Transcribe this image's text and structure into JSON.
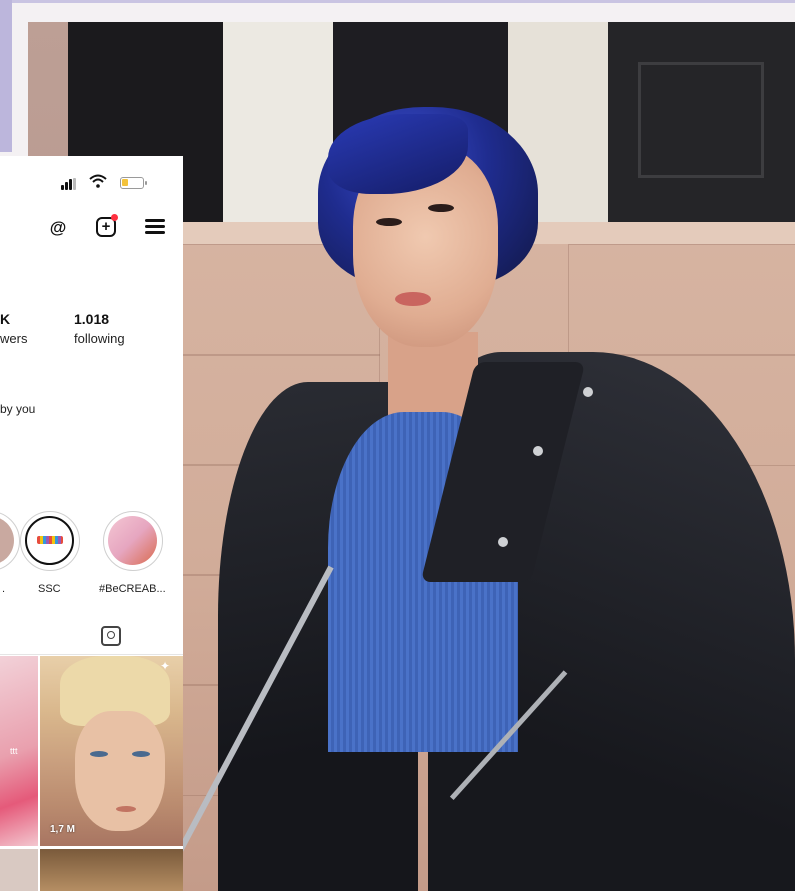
{
  "profile": {
    "followers": {
      "value": "K",
      "label": "wers"
    },
    "following": {
      "value": "1.018",
      "label": "following"
    },
    "mutual_text": "by you"
  },
  "highlights": [
    {
      "label": "."
    },
    {
      "label": "SSC"
    },
    {
      "label": "#BeCREAB..."
    }
  ],
  "grid": {
    "view_count": "1,7 M",
    "tile_text": "ttt"
  },
  "icons": {
    "signal": "signal-icon",
    "wifi": "wifi-icon",
    "battery": "battery-icon",
    "threads": "threads-icon",
    "create": "create-icon",
    "menu": "menu-icon",
    "tagged": "tagged-icon"
  },
  "colors": {
    "accent_lavender": "#bcb6dc",
    "notification_red": "#ff3040",
    "battery_yellow": "#f4c33b",
    "hair_blue": "#1f2c8f"
  }
}
